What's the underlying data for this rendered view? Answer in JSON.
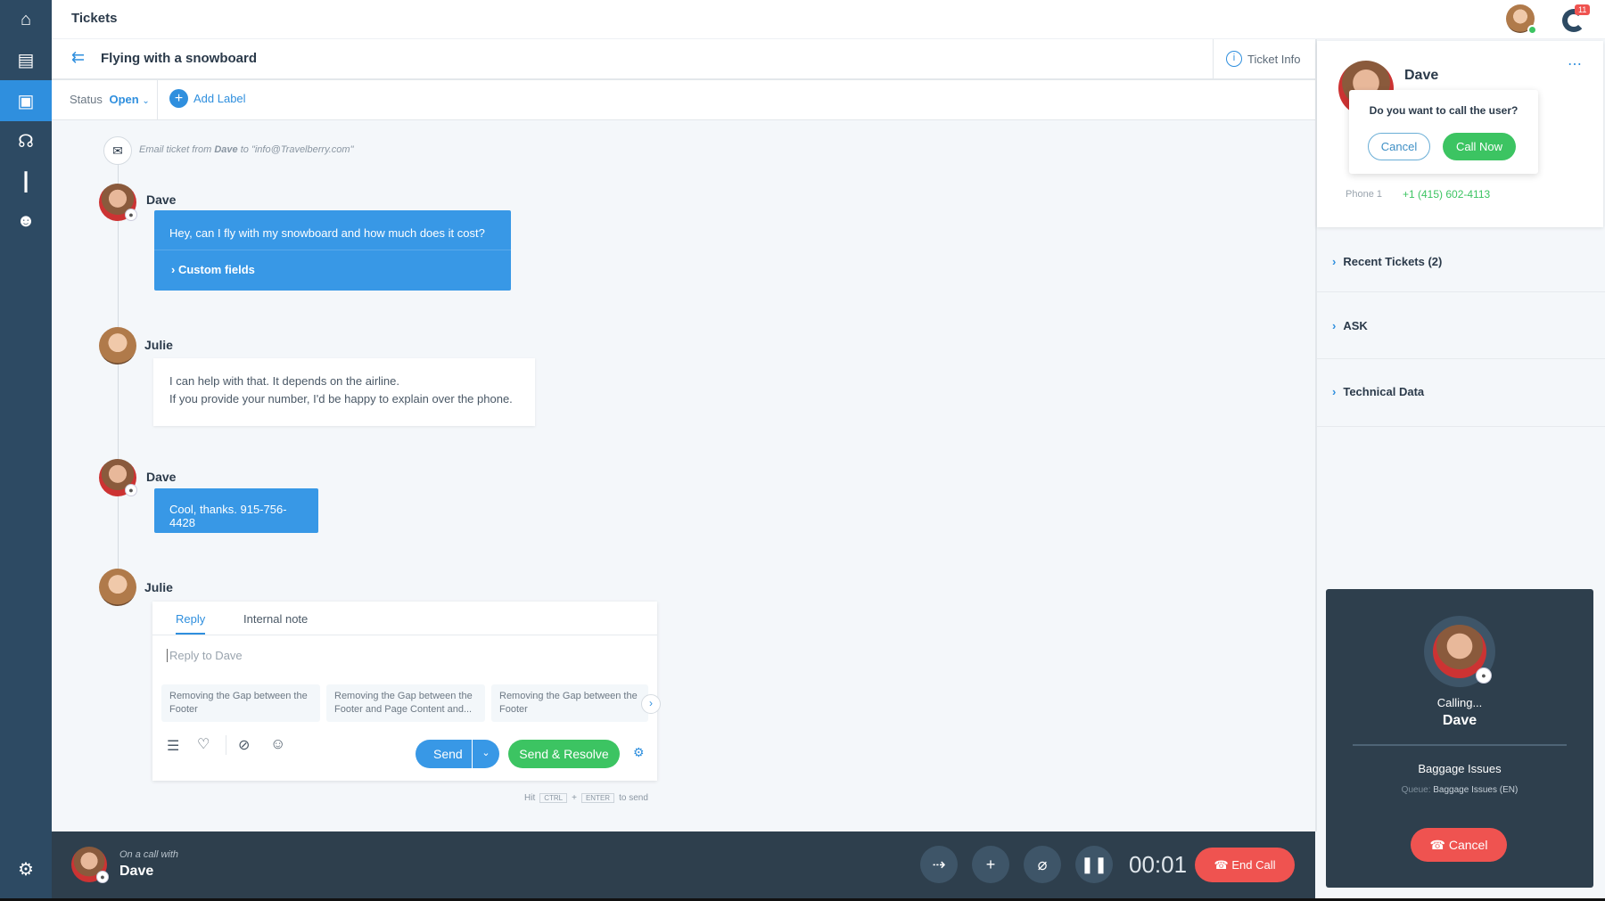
{
  "header": {
    "title": "Tickets",
    "notification_count": "11"
  },
  "ticket": {
    "subject": "Flying with a snowboard",
    "info_label": "Ticket Info",
    "status_label": "Status",
    "status_value": "Open",
    "add_label": "Add Label"
  },
  "conversation": {
    "email_note": {
      "prefix": "Email ticket from ",
      "sender": "Dave",
      "mid": " to ",
      "address": "\"info@Travelberry.com\""
    },
    "messages": [
      {
        "author": "Dave",
        "text": "Hey, can I fly with my snowboard and how much does it cost?",
        "extra": "Custom fields"
      },
      {
        "author": "Julie",
        "line1": "I can help with that. It depends on the airline.",
        "line2": "If you provide your number, I'd be happy to explain over the phone."
      },
      {
        "author": "Dave",
        "text": "Cool, thanks. 915-756-4428"
      },
      {
        "author": "Julie"
      }
    ]
  },
  "reply": {
    "tabs": [
      "Reply",
      "Internal note"
    ],
    "placeholder": "Reply to Dave",
    "suggestions": [
      {
        "line1": "Removing the Gap between the",
        "line2": "Footer"
      },
      {
        "line1": "Removing the Gap between the",
        "line2": "Footer and Page Content and..."
      },
      {
        "line1": "Removing the Gap between the",
        "line2": "Footer"
      }
    ],
    "send": "Send",
    "send_resolve": "Send & Resolve",
    "hint_pre": "Hit",
    "key1": "CTRL",
    "plus": "+",
    "key2": "ENTER",
    "hint_post": "to send"
  },
  "contact": {
    "name": "Dave",
    "popup_question": "Do you want to call the user?",
    "cancel": "Cancel",
    "call_now": "Call Now",
    "phone_label": "Phone 1",
    "phone": "+1 (415) 602-4113",
    "sections": [
      "Recent Tickets (2)",
      "ASK",
      "Technical Data"
    ]
  },
  "calling_card": {
    "status": "Calling...",
    "name": "Dave",
    "topic": "Baggage Issues",
    "queue_label": "Queue:",
    "queue": "Baggage Issues (EN)",
    "cancel": "Cancel"
  },
  "call_bar": {
    "caption": "On a call with",
    "name": "Dave",
    "timer": "00:01",
    "end_call": "End Call"
  },
  "colors": {
    "brand": "#2f8fde",
    "sidebar": "#2d4a63",
    "green": "#3cc462",
    "red": "#ef5350",
    "dark_panel": "#2e3f4d"
  }
}
